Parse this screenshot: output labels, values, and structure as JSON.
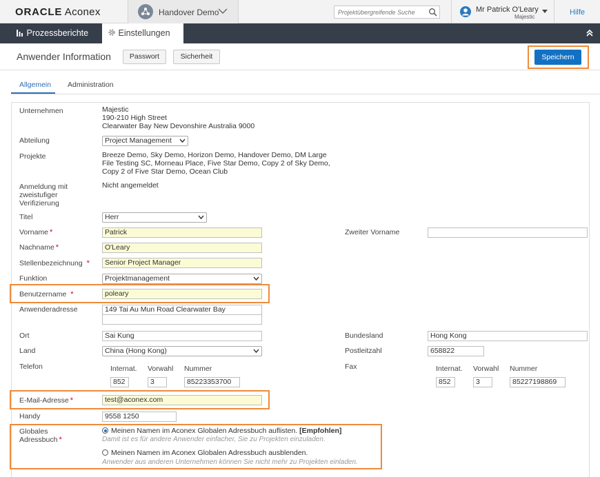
{
  "app": {
    "logo_brand": "ORACLE",
    "logo_product": "Aconex",
    "project_name": "Handover Demo",
    "search_placeholder": "Projektübergreifende Suche",
    "user_name": "Mr Patrick O'Leary",
    "user_org": "Majestic",
    "help_label": "Hilfe"
  },
  "nav": {
    "items": [
      {
        "label": "Prozessberichte",
        "icon": "bar-chart-icon"
      },
      {
        "label": "Einstellungen",
        "icon": "gear-icon"
      }
    ]
  },
  "header": {
    "title": "Anwender Information",
    "password_label": "Passwort",
    "security_label": "Sicherheit",
    "save_label": "Speichern"
  },
  "tabs": [
    {
      "label": "Allgemein",
      "active": true
    },
    {
      "label": "Administration",
      "active": false
    }
  ],
  "form": {
    "company_label": "Unternehmen",
    "company_lines": [
      "Majestic",
      "190-210 High Street",
      "Clearwater Bay New Devonshire Australia 9000"
    ],
    "department_label": "Abteilung",
    "department_value": "Project Management",
    "projects_label": "Projekte",
    "projects_lines": [
      "Breeze Demo, Sky Demo, Horizon Demo, Handover Demo, DM Large",
      "File Testing SC, Morneau Place, Five Star Demo, Copy 2 of Sky Demo,",
      "Copy 2 of Five Star Demo, Ocean Club"
    ],
    "twofactor_label_lines": [
      "Anmeldung mit",
      "zweistufiger",
      "Verifizierung"
    ],
    "twofactor_value": "Nicht angemeldet",
    "title_label": "Titel",
    "title_value": "Herr",
    "firstname_label": "Vorname",
    "firstname_value": "Patrick",
    "middlename_label": "Zweiter Vorname",
    "middlename_value": "",
    "lastname_label": "Nachname",
    "lastname_value": "O'Leary",
    "jobtitle_label": "Stellenbezeichnung",
    "jobtitle_value": "Senior Project Manager",
    "function_label": "Funktion",
    "function_value": "Projektmanagement",
    "username_label": "Benutzername",
    "username_value": "poleary",
    "address_label": "Anwenderadresse",
    "address_line1": "149 Tai Au Mun Road Clearwater Bay",
    "address_line2": "",
    "city_label": "Ort",
    "city_value": "Sai Kung",
    "state_label": "Bundesland",
    "state_value": "Hong Kong",
    "country_label": "Land",
    "country_value": "China (Hong Kong)",
    "postcode_label": "Postleitzahl",
    "postcode_value": "658822",
    "phone_label": "Telefon",
    "fax_label": "Fax",
    "col_intl": "Internat.",
    "col_area": "Vorwahl",
    "col_number": "Nummer",
    "phone_intl": "852",
    "phone_area": "3",
    "phone_number": "85223353700",
    "fax_intl": "852",
    "fax_area": "3",
    "fax_number": "85227198869",
    "email_label": "E-Mail-Adresse",
    "email_value": "test@aconex.com",
    "mobile_label": "Handy",
    "mobile_value": "9558 1250",
    "directory_label_lines": [
      "Globales",
      "Adressbuch"
    ],
    "directory_option1": "Meinen Namen im Aconex Globalen Adressbuch auflisten.",
    "directory_option1_badge": "[Empfohlen]",
    "directory_option1_hint": "Damit ist es für andere Anwender einfacher, Sie zu Projekten einzuladen.",
    "directory_option2": "Meinen Namen im Aconex Globalen Adressbuch ausblenden.",
    "directory_option2_hint": "Anwender aus anderen Unternehmen können Sie nicht mehr zu Projekten einladen.",
    "directory_selected": 1
  },
  "colors": {
    "accent_blue": "#1371c4",
    "nav_dark": "#363e4a",
    "highlight_orange": "#ef8a3a",
    "required_red": "#d0021b",
    "input_yellow": "#fbfbd6"
  }
}
